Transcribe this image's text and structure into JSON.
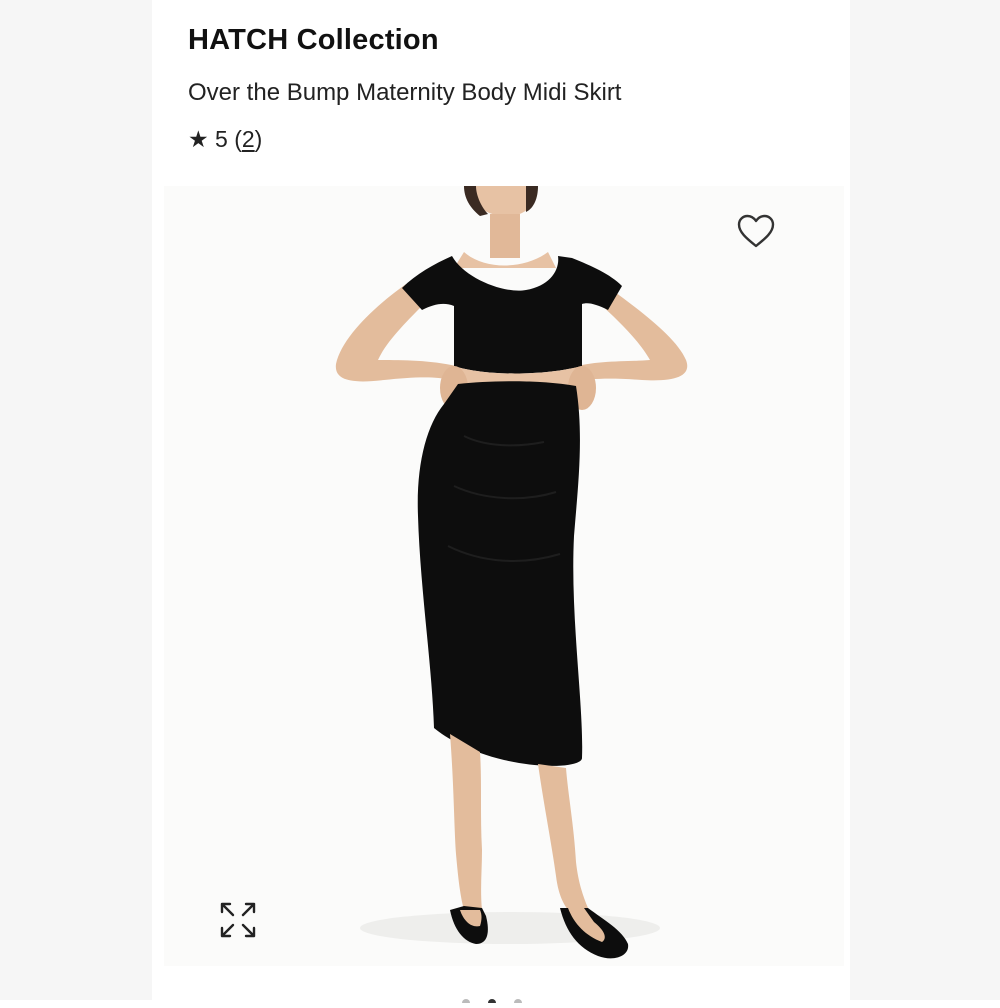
{
  "product": {
    "brand": "HATCH Collection",
    "title": "Over the Bump Maternity Body Midi Skirt",
    "rating": {
      "star_icon": "★",
      "value": "5",
      "open_paren": "(",
      "count": "2",
      "close_paren": ")"
    }
  },
  "image": {
    "alt": "Model wearing black crop top and black maternity midi skirt with black thong sandals",
    "favorite_icon": "heart-outline-icon",
    "expand_icon": "expand-arrows-icon"
  },
  "colors": {
    "page_bg": "#ffffff",
    "side_bg": "#f6f6f6",
    "text": "#111111",
    "icon": "#333333",
    "garment": "#0d0d0d",
    "skin": "#e7c2a4"
  }
}
